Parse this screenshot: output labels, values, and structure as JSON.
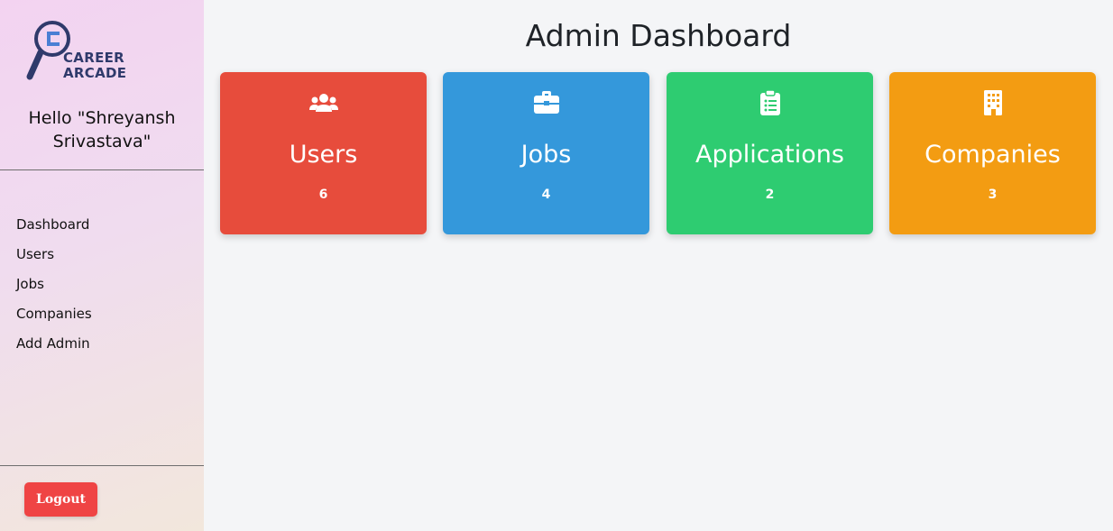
{
  "brand": {
    "line1": "CAREER",
    "line2": "ARCADE"
  },
  "sidebar": {
    "greeting": "Hello \"Shreyansh Srivastava\"",
    "items": [
      {
        "label": "Dashboard"
      },
      {
        "label": "Users"
      },
      {
        "label": "Jobs"
      },
      {
        "label": "Companies"
      },
      {
        "label": "Add Admin"
      }
    ],
    "logout_label": "Logout"
  },
  "main": {
    "title": "Admin Dashboard",
    "cards": [
      {
        "label": "Users",
        "value": "6",
        "color": "#e74c3c",
        "icon": "users-icon"
      },
      {
        "label": "Jobs",
        "value": "4",
        "color": "#3498db",
        "icon": "briefcase-icon"
      },
      {
        "label": "Applications",
        "value": "2",
        "color": "#2ecc71",
        "icon": "clipboard-list-icon"
      },
      {
        "label": "Companies",
        "value": "3",
        "color": "#f39c12",
        "icon": "building-icon"
      }
    ]
  },
  "colors": {
    "logout": "#ef4444",
    "brand_text": "#2f3a6b",
    "logo_accent": "#4a7fd4"
  }
}
